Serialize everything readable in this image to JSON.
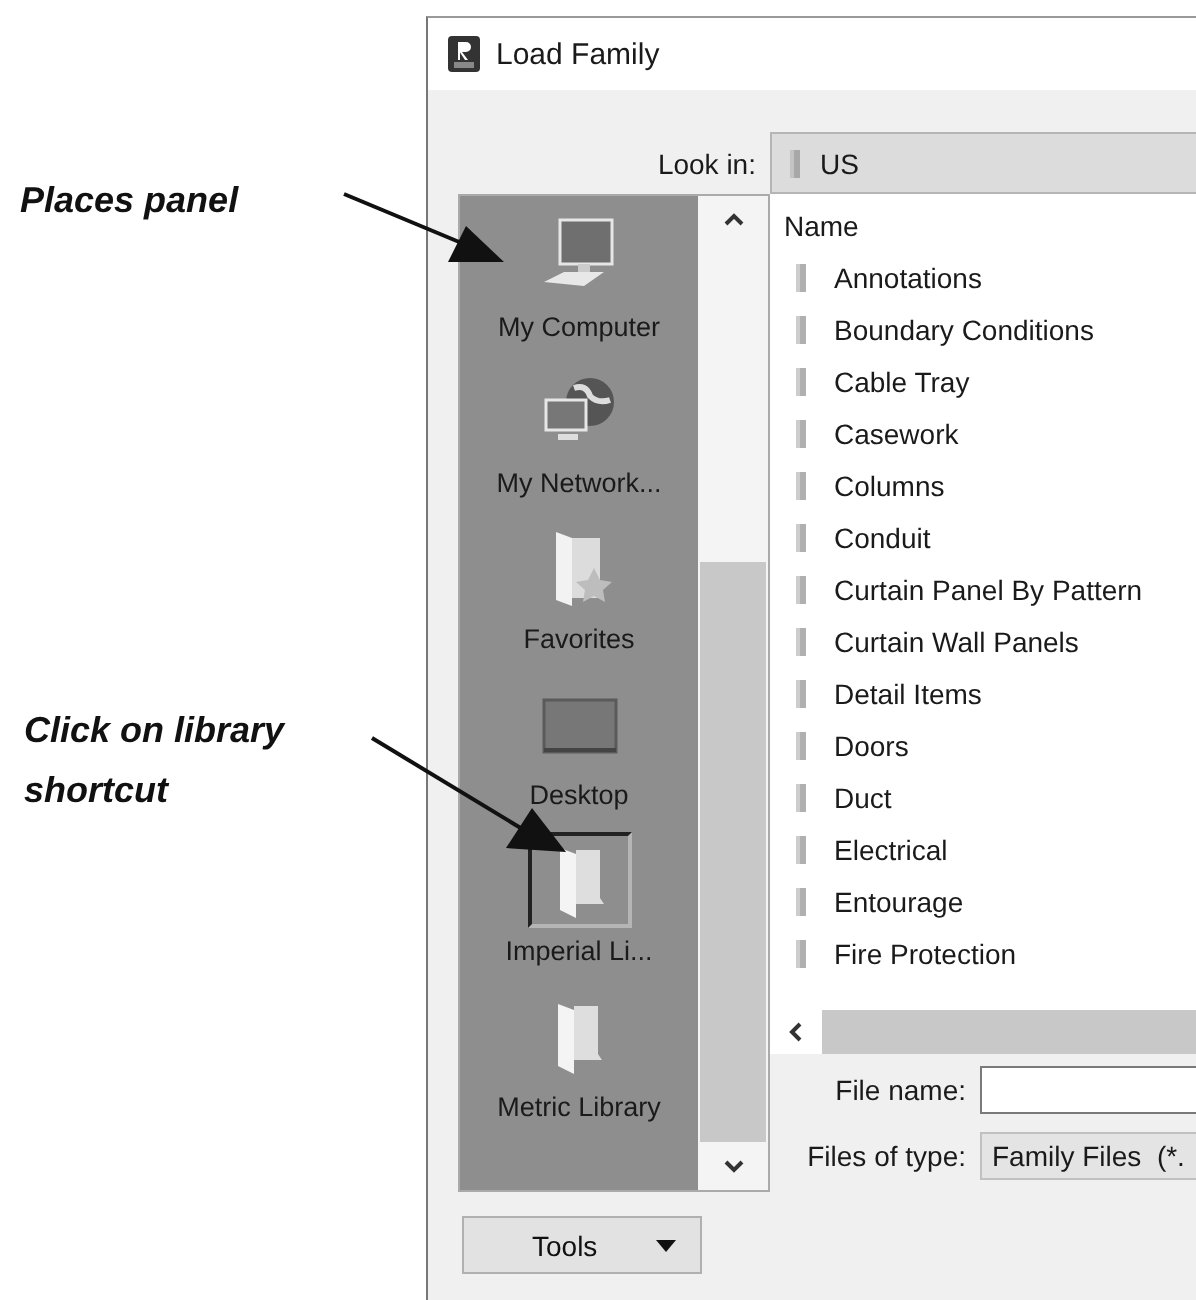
{
  "annotations": [
    {
      "text": "Places panel"
    },
    {
      "text": "Click on library shortcut"
    }
  ],
  "dialog": {
    "title": "Load Family",
    "look_in": {
      "label": "Look in:",
      "value": "US"
    },
    "places": [
      {
        "label": "My Computer",
        "kind": "computer",
        "selected": false
      },
      {
        "label": "My Network...",
        "kind": "network",
        "selected": false
      },
      {
        "label": "Favorites",
        "kind": "favorites",
        "selected": false
      },
      {
        "label": "Desktop",
        "kind": "desktop",
        "selected": false
      },
      {
        "label": "Imperial Li...",
        "kind": "folder",
        "selected": true
      },
      {
        "label": "Metric Library",
        "kind": "folder",
        "selected": false
      }
    ],
    "list": {
      "header": "Name",
      "items": [
        "Annotations",
        "Boundary Conditions",
        "Cable Tray",
        "Casework",
        "Columns",
        "Conduit",
        "Curtain Panel By Pattern",
        "Curtain Wall Panels",
        "Detail Items",
        "Doors",
        "Duct",
        "Electrical",
        "Entourage",
        "Fire Protection"
      ]
    },
    "file_name": {
      "label": "File name:"
    },
    "files_of_type": {
      "label": "Files of type:",
      "value": "Family Files  (*."
    },
    "tools": {
      "label": "Tools"
    }
  }
}
